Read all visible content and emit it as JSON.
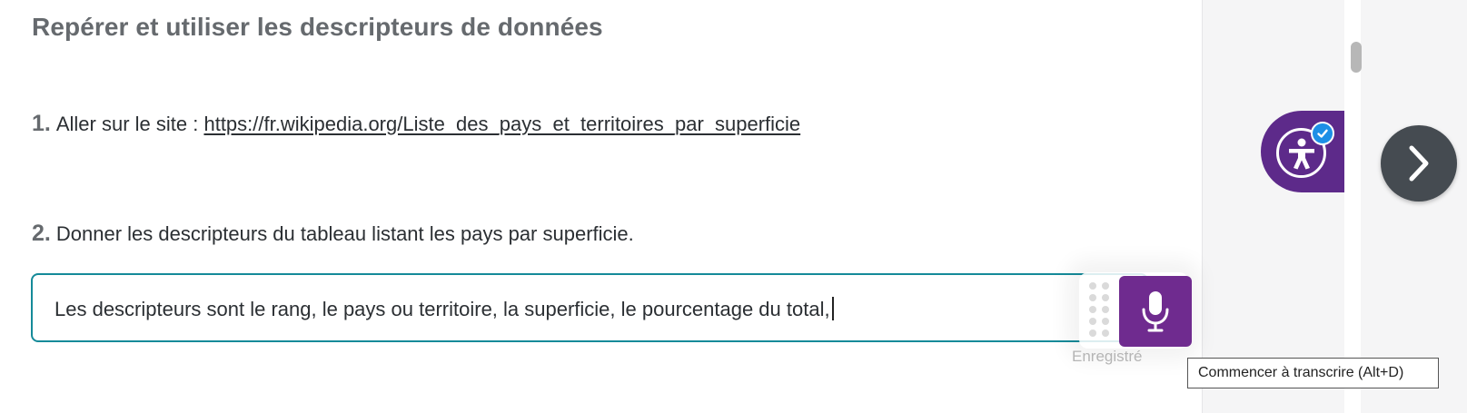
{
  "page": {
    "title": "Repérer et utiliser les descripteurs de données"
  },
  "steps": [
    {
      "number": "1.",
      "text": "Aller sur le site : ",
      "link": "https://fr.wikipedia.org/Liste_des_pays_et_territoires_par_superficie"
    },
    {
      "number": "2.",
      "text": "Donner les descripteurs du tableau listant les pays par superficie."
    }
  ],
  "answer": {
    "value": "Les descripteurs sont le rang, le pays ou territoire, la superficie, le pourcentage du total,"
  },
  "dictation": {
    "status": "Enregistré",
    "tooltip": "Commencer à transcrire (Alt+D)",
    "mic_icon": "microphone-icon",
    "handle_icon": "drag-handle-icon"
  },
  "sidebar": {
    "accessibility_icon": "accessibility-icon",
    "badge_icon": "check-badge-icon",
    "next_icon": "chevron-right-icon"
  },
  "colors": {
    "accent_teal": "#158a99",
    "mic_purple": "#6f2b8f",
    "widget_purple": "#5d2a8a",
    "badge_blue": "#1d8fe6",
    "next_button": "#454b51"
  }
}
